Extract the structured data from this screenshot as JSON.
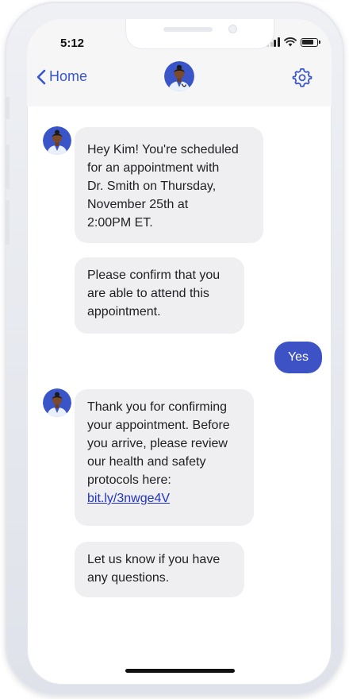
{
  "status_bar": {
    "time": "5:12"
  },
  "nav": {
    "back_label": "Home"
  },
  "messages": {
    "m1": "Hey Kim! You're scheduled\nfor an appointment with\nDr. Smith on Thursday,\nNovember 25th at\n2:00PM ET.",
    "m2": "Please confirm that you\nare able to attend this\nappointment.",
    "reply": "Yes",
    "m3": "Thank you for confirming\nyour appointment. Before\nyou arrive, please review\nour health and safety\nprotocols here:",
    "m3_link": "bit.ly/3nwge4V",
    "m4": "Let us know if you have\nany questions."
  },
  "colors": {
    "accent": "#3d53c5",
    "link": "#2333c2",
    "bubble_bg": "#efeff1",
    "header_bg": "#f6f6f7",
    "avatar_bg": "#3a55c8"
  },
  "icons": {
    "back": "chevron-left-icon",
    "settings": "gear-icon",
    "avatar": "doctor-avatar-icon"
  }
}
